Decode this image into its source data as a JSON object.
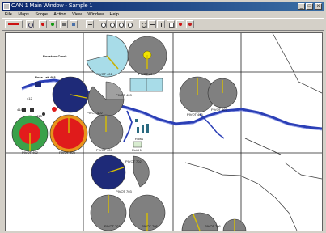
{
  "window": {
    "title": "CAN 1 Main Window - Sample 1",
    "min_label": "_",
    "max_label": "□",
    "close_label": "x"
  },
  "menu": {
    "items": [
      "File",
      "Maps",
      "Scope",
      "Action",
      "View",
      "Window",
      "Help"
    ]
  },
  "toolbar": {
    "icons": [
      "stop-sign-icon",
      "refresh-icon",
      "record-red-icon",
      "run-green-icon",
      "grid-icon",
      "table-icon",
      "link-icon",
      "zoom-in-icon",
      "zoom-out-icon",
      "zoom-region-icon",
      "zoom-fit-icon",
      "rotate-icon",
      "measure-icon",
      "info-icon",
      "sheet-icon",
      "alert-icon",
      "alarm-icon"
    ]
  },
  "map": {
    "labels": {
      "creek": "Boosters Creek",
      "pump": "Rosa Lak 403",
      "s412": "412",
      "s413": "413",
      "s414": "414",
      "pivot404": "PIVOT 404",
      "pivot403": "PIVOT 403",
      "pivot402": "PIVOT 402",
      "pivot401": "PIVOT 401",
      "pivot406": "PIVOT 406",
      "pivot409": "PIVOT 409",
      "pivot407": "PIVOT 407",
      "pivot702": "PIVOT 702",
      "pivot703": "PIVOT 703",
      "pivot701": "PIVOT 701",
      "pivot705": "PIVOT 705",
      "pivot706": "PIVOT 706",
      "pivot708": "PIVOT 708",
      "rows": "Rows",
      "field": "Field 1"
    }
  }
}
